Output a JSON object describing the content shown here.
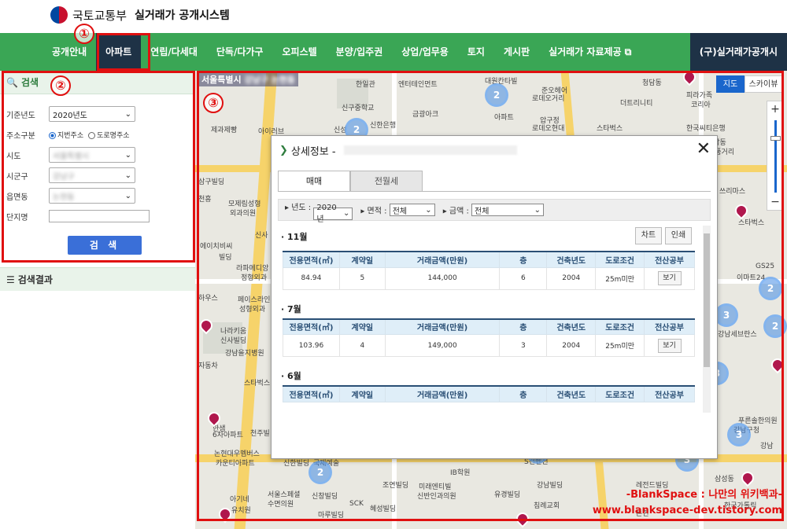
{
  "header": {
    "ministry": "국토교통부",
    "system": "실거래가 공개시스템"
  },
  "nav": {
    "items": [
      "공개안내",
      "아파트",
      "연립/다세대",
      "단독/다가구",
      "오피스텔",
      "분양/입주권",
      "상업/업무용",
      "토지",
      "게시판",
      "실거래가 자료제공 ⧉"
    ],
    "dark_item": "(구)실거래가공개시",
    "active_index": 1
  },
  "annotations": {
    "one": "①",
    "two": "②",
    "three": "③"
  },
  "search": {
    "title": "검색",
    "year_label": "기준년도",
    "year_value": "2020년도",
    "addr_type_label": "주소구분",
    "addr_opt1": "지번주소",
    "addr_opt2": "도로명주소",
    "city_label": "시도",
    "city_value": "서울특별시",
    "district_label": "시군구",
    "district_value": "강남구",
    "dong_label": "읍면동",
    "dong_value": "논현동",
    "complex_label": "단지명",
    "button": "검 색",
    "results_title": "검색결과"
  },
  "map": {
    "title_prefix": "서울특별시",
    "title_blurred": "강남구 논현동",
    "type_map": "지도",
    "type_sky": "스카이뷰",
    "labels": [
      "한일관",
      "대원칸타빌",
      "청담동",
      "엔터테인먼트",
      "준오헤어",
      "피라가족",
      "신구중학교",
      "더트리니티",
      "코리아",
      "금광아크",
      "로데오현대",
      "한국씨티은행",
      "제과제빵",
      "신성",
      "신한은행",
      "아파트",
      "압구정",
      "청담동",
      "명품거리",
      "아이러브",
      "로데오거리",
      "스타벅스",
      "삼구빌딩",
      "천흥",
      "모제림성형",
      "외과의원",
      "신사",
      "에이치비씨",
      "빌딩",
      "라파메디앙",
      "정형외과",
      "하우스",
      "페이스라인",
      "성형외과",
      "나라키움",
      "신사빌딩",
      "강남을지병원",
      "자동차",
      "스타벅스",
      "한샘",
      "6차아파트",
      "천주빌",
      "논현대우멤버스",
      "카운티아파트",
      "아기네",
      "서울스페셜",
      "수면의원",
      "유치원",
      "신한빌딩",
      "국제예술",
      "신창빌딩",
      "조연빌딩",
      "미래엔티빌",
      "신반인과의원",
      "SCK",
      "마루빌딩",
      "혜성빌딩",
      "S컨벤션",
      "강남빌딩",
      "침례교회",
      "논현",
      "유경빌딩",
      "IB학원",
      "이마트24",
      "GS25",
      "강남세브란스",
      "푸른솔한의원",
      "강남구청",
      "삼성동",
      "강남",
      "레전드빌딩",
      "한국가톨릭",
      "쓰리마스",
      "스타벅스"
    ],
    "clusters": [
      "2",
      "2",
      "3",
      "2",
      "3",
      "3",
      "3",
      "2",
      "2",
      "3"
    ],
    "watermark1": "-BlankSpace : 나만의 위키백과-",
    "watermark2": "www.blankspace-dev.tistory.com"
  },
  "modal": {
    "title": "상세정보 -",
    "tab_sale": "매매",
    "tab_rent": "전월세",
    "filter_year_label": "년도 :",
    "filter_year_value": "2020년",
    "filter_area_label": "면적 :",
    "filter_area_value": "전체",
    "filter_price_label": "금액 :",
    "filter_price_value": "전체",
    "btn_chart": "차트",
    "btn_print": "인쇄",
    "columns": [
      "전용면적(㎡)",
      "계약일",
      "거래금액(만원)",
      "층",
      "건축년도",
      "도로조건",
      "전산공부"
    ],
    "months": [
      {
        "title": "11월",
        "rows": [
          [
            "84.94",
            "5",
            "144,000",
            "6",
            "2004",
            "25m미만",
            "보기"
          ]
        ]
      },
      {
        "title": "7월",
        "rows": [
          [
            "103.96",
            "4",
            "149,000",
            "3",
            "2004",
            "25m미만",
            "보기"
          ]
        ]
      },
      {
        "title": "6월",
        "rows": []
      }
    ]
  }
}
